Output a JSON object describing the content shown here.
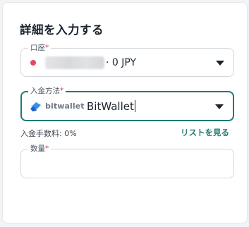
{
  "form": {
    "title": "詳細を入力する",
    "required_mark": "*"
  },
  "account": {
    "label": "口座",
    "value": "· 0 JPY",
    "status_color": "#e8485f",
    "icon": "chevron-down-icon"
  },
  "deposit_method": {
    "label": "入金方法",
    "logo_text": "bitwallet",
    "value": "BitWallet",
    "icon": "chevron-down-icon",
    "logo_icon": "bitwallet-logo-icon"
  },
  "fee": {
    "text": "入金手数料: 0%"
  },
  "list_link": {
    "label": "リストを見る"
  },
  "quantity": {
    "label": "数量",
    "value": ""
  },
  "colors": {
    "accent": "#1f7a76",
    "required": "#e0395b"
  }
}
